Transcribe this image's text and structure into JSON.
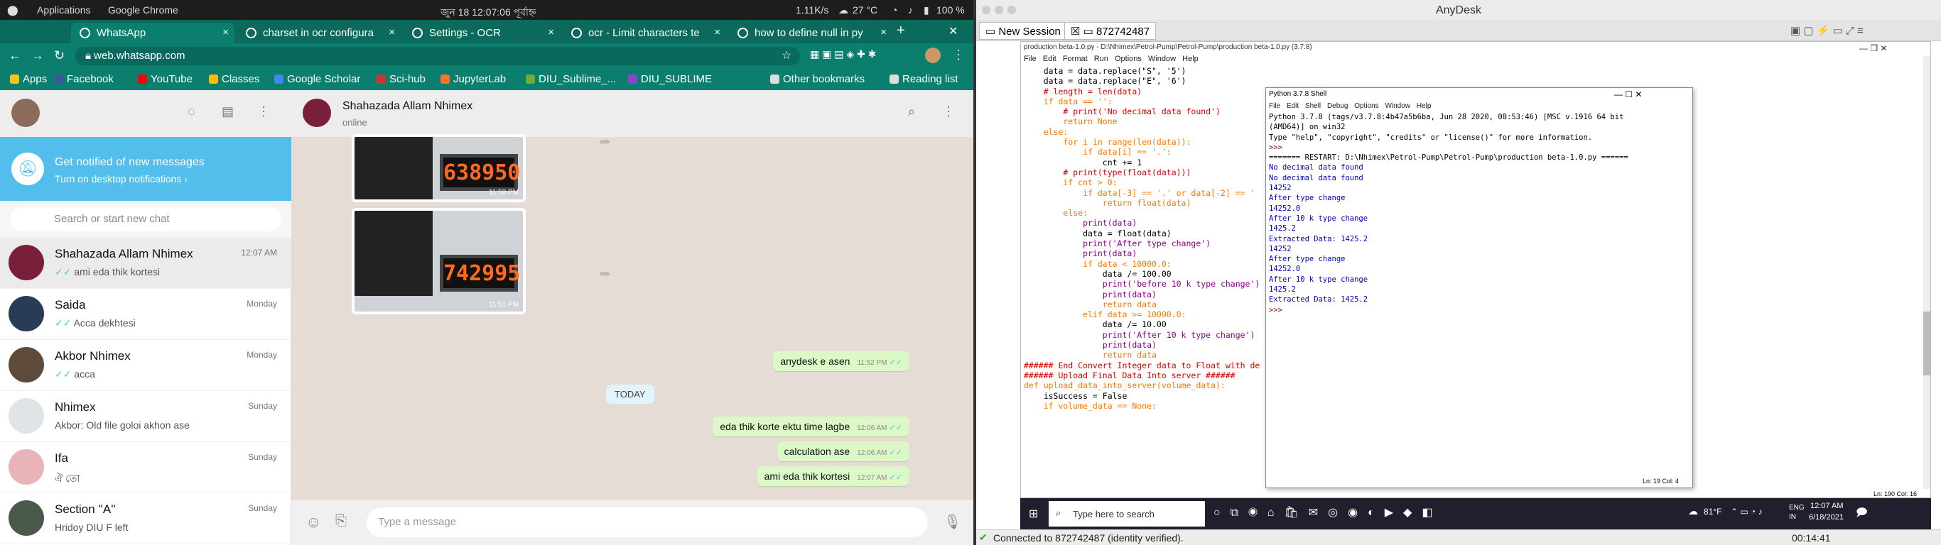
{
  "system_bar": {
    "activities": "Applications",
    "app": "Google Chrome",
    "clock": "জুন 18  12:07:06 পূর্বাহ্ন",
    "net": "1.11K/s",
    "weather": "27 °C",
    "battery": "100 %"
  },
  "tabs": [
    {
      "label": "WhatsApp"
    },
    {
      "label": "charset in ocr configura"
    },
    {
      "label": "Settings - OCR"
    },
    {
      "label": "ocr - Limit characters te"
    },
    {
      "label": "how to define null in py"
    }
  ],
  "address": {
    "url": "web.whatsapp.com"
  },
  "bookmarks": [
    {
      "label": "Apps"
    },
    {
      "label": "Facebook"
    },
    {
      "label": "YouTube"
    },
    {
      "label": "Classes"
    },
    {
      "label": "Google Scholar"
    },
    {
      "label": "Sci-hub"
    },
    {
      "label": "JupyterLab"
    },
    {
      "label": "DIU_Sublime_..."
    },
    {
      "label": "DIU_SUBLIME"
    },
    {
      "label": "Other bookmarks"
    },
    {
      "label": "Reading list"
    }
  ],
  "notify": {
    "title": "Get notified of new messages",
    "link": "Turn on desktop notifications ›"
  },
  "search": {
    "placeholder": "Search or start new chat"
  },
  "chats": [
    {
      "name": "Shahazada Allam Nhimex",
      "preview": "ami eda thik kortesi",
      "time": "12:07 AM"
    },
    {
      "name": "Saida",
      "preview": "Acca dekhtesi",
      "time": "Monday"
    },
    {
      "name": "Akbor Nhimex",
      "preview": "acca",
      "time": "Monday"
    },
    {
      "name": "Nhimex",
      "preview": "Akbor: Old file goloi akhon ase",
      "time": "Sunday"
    },
    {
      "name": "Ifa",
      "preview": "ঐ তো",
      "time": "Sunday"
    },
    {
      "name": "Section ''A''",
      "preview": "Hridoy DIU F left",
      "time": "Sunday"
    }
  ],
  "conversation": {
    "name": "Shahazada Allam Nhimex",
    "status": "online",
    "img1_reading": "638950",
    "img1_time": "11:50 PM",
    "img2_reading": "742995",
    "img2_time": "11:51 PM",
    "today": "TODAY",
    "placeholder": "Type a message",
    "messages": [
      {
        "text": "anydesk e asen",
        "time": "11:52 PM"
      },
      {
        "text": "eda thik korte ektu time lagbe",
        "time": "12:06 AM"
      },
      {
        "text": "calculation ase",
        "time": "12:06 AM"
      },
      {
        "text": "ami eda thik kortesi",
        "time": "12:07 AM"
      }
    ]
  },
  "anydesk": {
    "title": "AnyDesk",
    "new_session": "New Session",
    "session_id": "872742487",
    "status": "Connected to 872742487 (identity verified).",
    "elapsed": "00:14:41"
  },
  "ide": {
    "title": "production beta-1.0.py - D:\\Nhimex\\Petrol-Pump\\Petrol-Pump\\production beta-1.0.py (3.7.8)",
    "menu": [
      "File",
      "Edit",
      "Format",
      "Run",
      "Options",
      "Window",
      "Help"
    ],
    "lines": [
      "    data = data.replace(\"S\", '5')",
      "    data = data.replace(\"E\", '6')",
      "    # length = len(data)",
      "",
      "    if data == '':",
      "        # print('No decimal data found')",
      "        return None",
      "    else:",
      "        for i in range(len(data)):",
      "            if data[i] == '.':",
      "                cnt += 1",
      "",
      "        # print(type(float(data)))",
      "        if cnt > 0:",
      "            if data[-3] == '.' or data[-2] == '",
      "                return float(data)",
      "        else:",
      "            print(data)",
      "            data = float(data)",
      "            print('After type change')",
      "            print(data)",
      "            if data < 10000.0:",
      "                data /= 100.00",
      "                print('before 10 k type change')",
      "                print(data)",
      "                return data",
      "",
      "            elif data >= 10000.0:",
      "                data /= 10.00",
      "                print('After 10 k type change')",
      "                print(data)",
      "                return data",
      "",
      "###### End Convert Integer data to Float with de",
      "",
      "",
      "###### Upload Final Data Into server ######",
      "",
      "def upload_data_into_server(volume_data):",
      "    isSuccess = False",
      "    if volume_data == None:"
    ],
    "status": "Ln: 190   Col: 16"
  },
  "shell": {
    "title": "Python 3.7.8 Shell",
    "menu": [
      "File",
      "Edit",
      "Shell",
      "Debug",
      "Options",
      "Window",
      "Help"
    ],
    "lines": [
      "Python 3.7.8 (tags/v3.7.8:4b47a5b6ba, Jun 28 2020, 08:53:46) [MSC v.1916 64 bit",
      "(AMD64)] on win32",
      "Type \"help\", \"copyright\", \"credits\" or \"license()\" for more information.",
      ">>> ",
      "======= RESTART: D:\\Nhimex\\Petrol-Pump\\Petrol-Pump\\production beta-1.0.py ======",
      "No decimal data found",
      "No decimal data found",
      "14252",
      "After type change",
      "14252.0",
      "After 10 k type change",
      "1425.2",
      "Extracted Data: 1425.2",
      "14252",
      "After type change",
      "14252.0",
      "After 10 k type change",
      "1425.2",
      "Extracted Data: 1425.2",
      ">>> "
    ],
    "status": "Ln: 19   Col: 4"
  },
  "win_taskbar": {
    "search": "Type here to search",
    "temp": "81°F",
    "lang": "ENG\nIN",
    "time": "12:07 AM",
    "date": "6/18/2021"
  }
}
